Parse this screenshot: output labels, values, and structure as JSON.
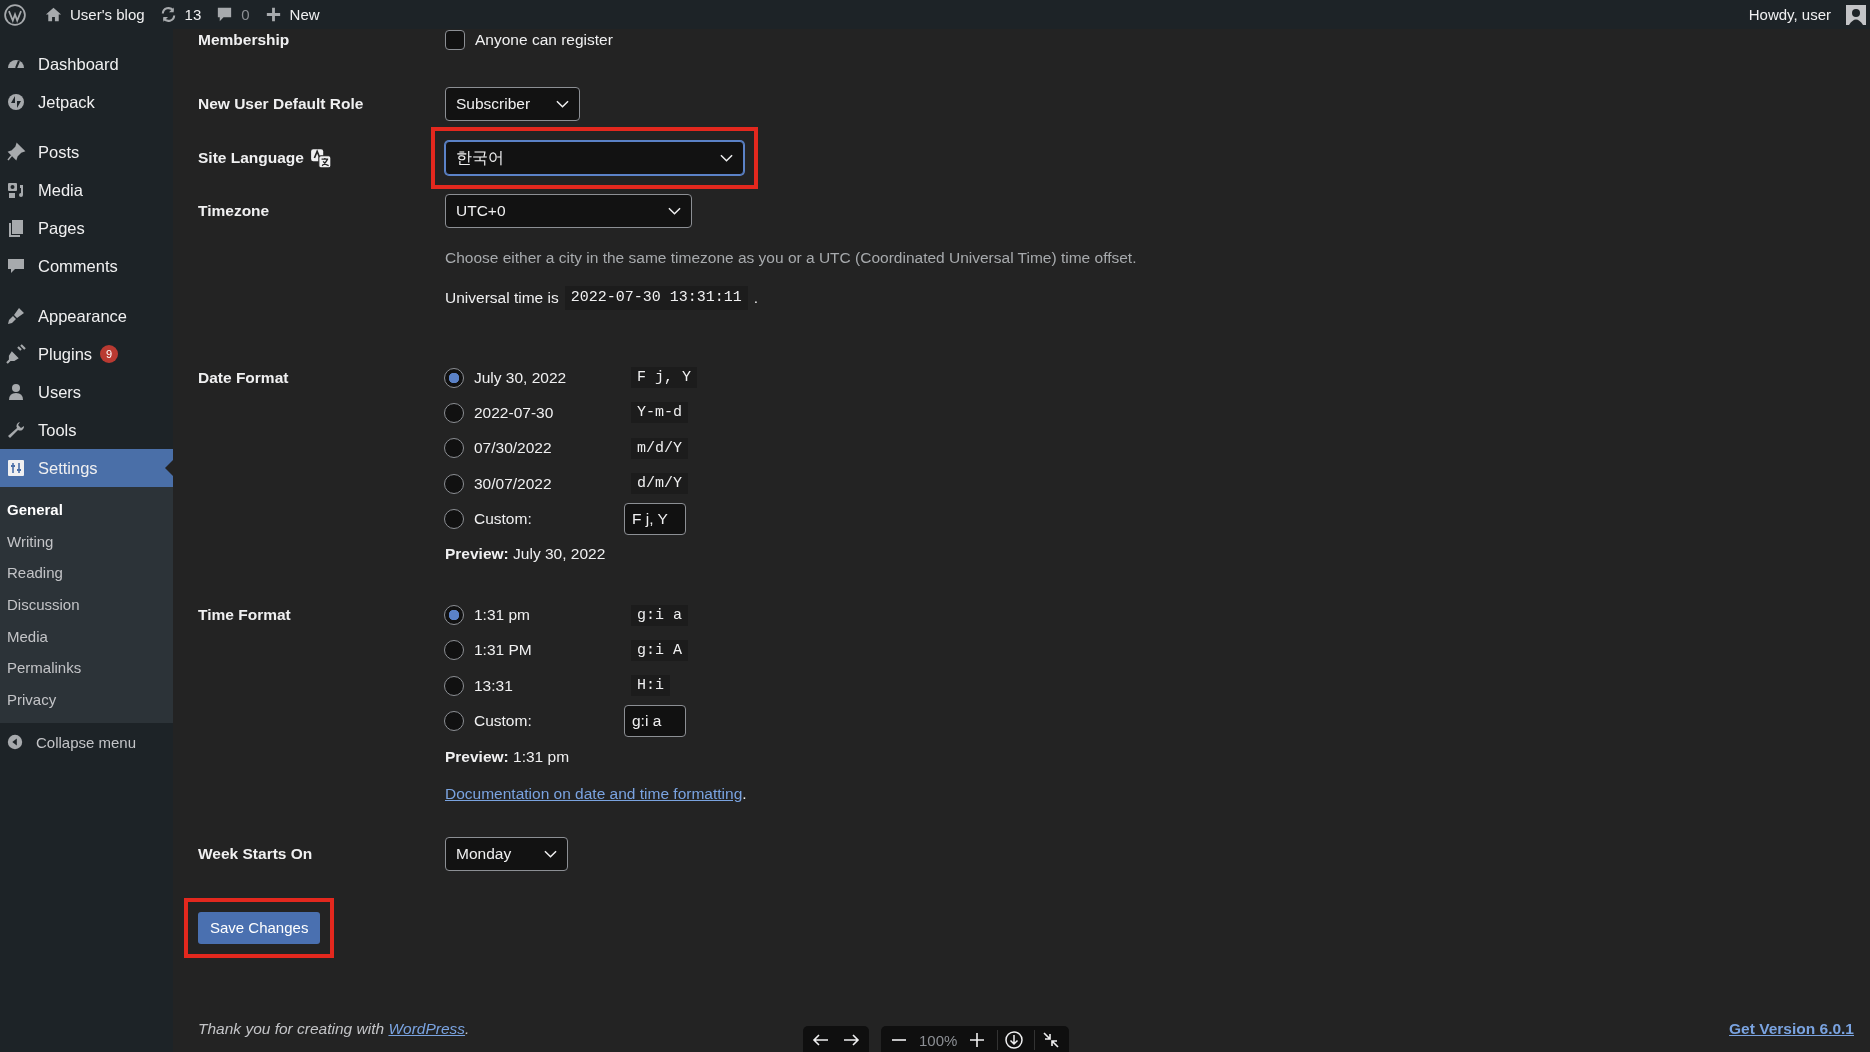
{
  "admin_bar": {
    "site_name": "User's blog",
    "updates": "13",
    "comments": "0",
    "new": "New",
    "greeting": "Howdy, user"
  },
  "sidebar": {
    "groups": [
      {
        "items": [
          {
            "label": "Dashboard",
            "selected": false
          },
          {
            "label": "Jetpack",
            "selected": false
          }
        ]
      },
      {
        "items": [
          {
            "label": "Posts",
            "selected": false
          },
          {
            "label": "Media",
            "selected": false
          },
          {
            "label": "Pages",
            "selected": false
          },
          {
            "label": "Comments",
            "selected": false
          }
        ]
      },
      {
        "items": [
          {
            "label": "Appearance",
            "selected": false
          },
          {
            "label": "Plugins",
            "selected": false,
            "badge": "9"
          },
          {
            "label": "Users",
            "selected": false
          },
          {
            "label": "Tools",
            "selected": false
          },
          {
            "label": "Settings",
            "selected": true
          }
        ]
      }
    ],
    "submenu": [
      {
        "label": "General",
        "selected": true
      },
      {
        "label": "Writing",
        "selected": false
      },
      {
        "label": "Reading",
        "selected": false
      },
      {
        "label": "Discussion",
        "selected": false
      },
      {
        "label": "Media",
        "selected": false
      },
      {
        "label": "Permalinks",
        "selected": false
      },
      {
        "label": "Privacy",
        "selected": false
      }
    ],
    "collapse": "Collapse menu"
  },
  "form": {
    "membership": {
      "label": "Membership",
      "checkbox_label": "Anyone can register",
      "checked": false
    },
    "default_role": {
      "label": "New User Default Role",
      "value": "Subscriber",
      "highlighted": false
    },
    "site_language": {
      "label": "Site Language",
      "value": "한국어",
      "highlighted": true,
      "focused": true
    },
    "timezone": {
      "label": "Timezone",
      "value": "UTC+0",
      "description": "Choose either a city in the same timezone as you or a UTC (Coordinated Universal Time) time offset.",
      "universal_label": "Universal time is",
      "universal_value": "2022-07-30 13:31:11",
      "universal_suffix": "."
    },
    "date_format": {
      "label": "Date Format",
      "options": [
        {
          "kind": "preset",
          "label": "July 30, 2022",
          "code": "F j, Y",
          "selected": true
        },
        {
          "kind": "preset",
          "label": "2022-07-30",
          "code": "Y-m-d",
          "selected": false
        },
        {
          "kind": "preset",
          "label": "07/30/2022",
          "code": "m/d/Y",
          "selected": false
        },
        {
          "kind": "preset",
          "label": "30/07/2022",
          "code": "d/m/Y",
          "selected": false
        },
        {
          "kind": "custom",
          "label": "Custom:",
          "code": "F j, Y",
          "selected": false
        }
      ],
      "preview": "**Preview:** July 30, 2022"
    },
    "time_format": {
      "label": "Time Format",
      "options": [
        {
          "kind": "preset",
          "label": "1:31 pm",
          "code": "g:i a",
          "selected": true
        },
        {
          "kind": "preset",
          "label": "1:31 PM",
          "code": "g:i A",
          "selected": false
        },
        {
          "kind": "preset",
          "label": "13:31",
          "code": "H:i",
          "selected": false
        },
        {
          "kind": "custom",
          "label": "Custom:",
          "code": "g:i a",
          "selected": false
        }
      ],
      "preview": "**Preview:** 1:31 pm"
    },
    "doc_link": {
      "text": "Documentation on date and time formatting",
      "suffix": "."
    },
    "week_starts": {
      "label": "Week Starts On",
      "value": "Monday"
    },
    "save_button": {
      "label": "Save Changes",
      "highlighted": true
    }
  },
  "footer": {
    "thanks": "Thank you for creating with",
    "link": "WordPress",
    "suffix": ".",
    "version": "Get Version 6.0.1"
  },
  "viewer_toolbar": {
    "zoom": "100%"
  }
}
